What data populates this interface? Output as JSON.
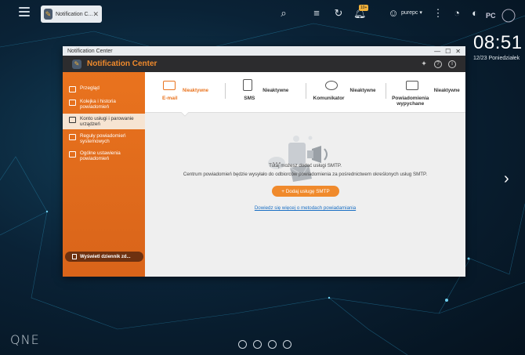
{
  "taskbar": {
    "tab_label": "Notification C...",
    "tab_close": "✕",
    "badge": "10+",
    "user": "purepc",
    "user_caret": "▾"
  },
  "clock": {
    "time": "08:51",
    "date": "12/23 Poniedziałek"
  },
  "desktop": {
    "brand": "QNE"
  },
  "window": {
    "title": "Notification Center",
    "controls": [
      "—",
      "☐",
      "✕"
    ],
    "app_title": "Notification Center"
  },
  "sidebar": {
    "items": [
      {
        "label": "Przegląd",
        "active": false
      },
      {
        "label": "Kolejka i historia powiadomień",
        "active": false
      },
      {
        "label": "Konto usługi i parowanie urządzeń",
        "active": true
      },
      {
        "label": "Reguły powiadomień systemowych",
        "active": false
      },
      {
        "label": "Ogólne ustawienia powiadomień",
        "active": false
      }
    ],
    "footer_button": "Wyświetl dziennik zd..."
  },
  "tabs": [
    {
      "name": "E-mail",
      "status": "Nieaktywne"
    },
    {
      "name": "SMS",
      "status": "Nieaktywne"
    },
    {
      "name": "Komunikator",
      "status": "Nieaktywne"
    },
    {
      "name": "Powiadomienia wypychane",
      "status": "Nieaktywne"
    }
  ],
  "content": {
    "info_line1": "Tutaj możesz dodać usługi SMTP.",
    "info_line2": "Centrum powiadomień będzie wysyłało do odbiorców powiadomienia za pośrednictwem określonych usług SMTP.",
    "add_button": "+ Dodaj usługę SMTP",
    "learn_more": "Dowiedz się więcej o metodach powiadamiania"
  },
  "colors": {
    "accent": "#e9731e",
    "link": "#1a6fc4",
    "header": "#2c2c2e"
  }
}
